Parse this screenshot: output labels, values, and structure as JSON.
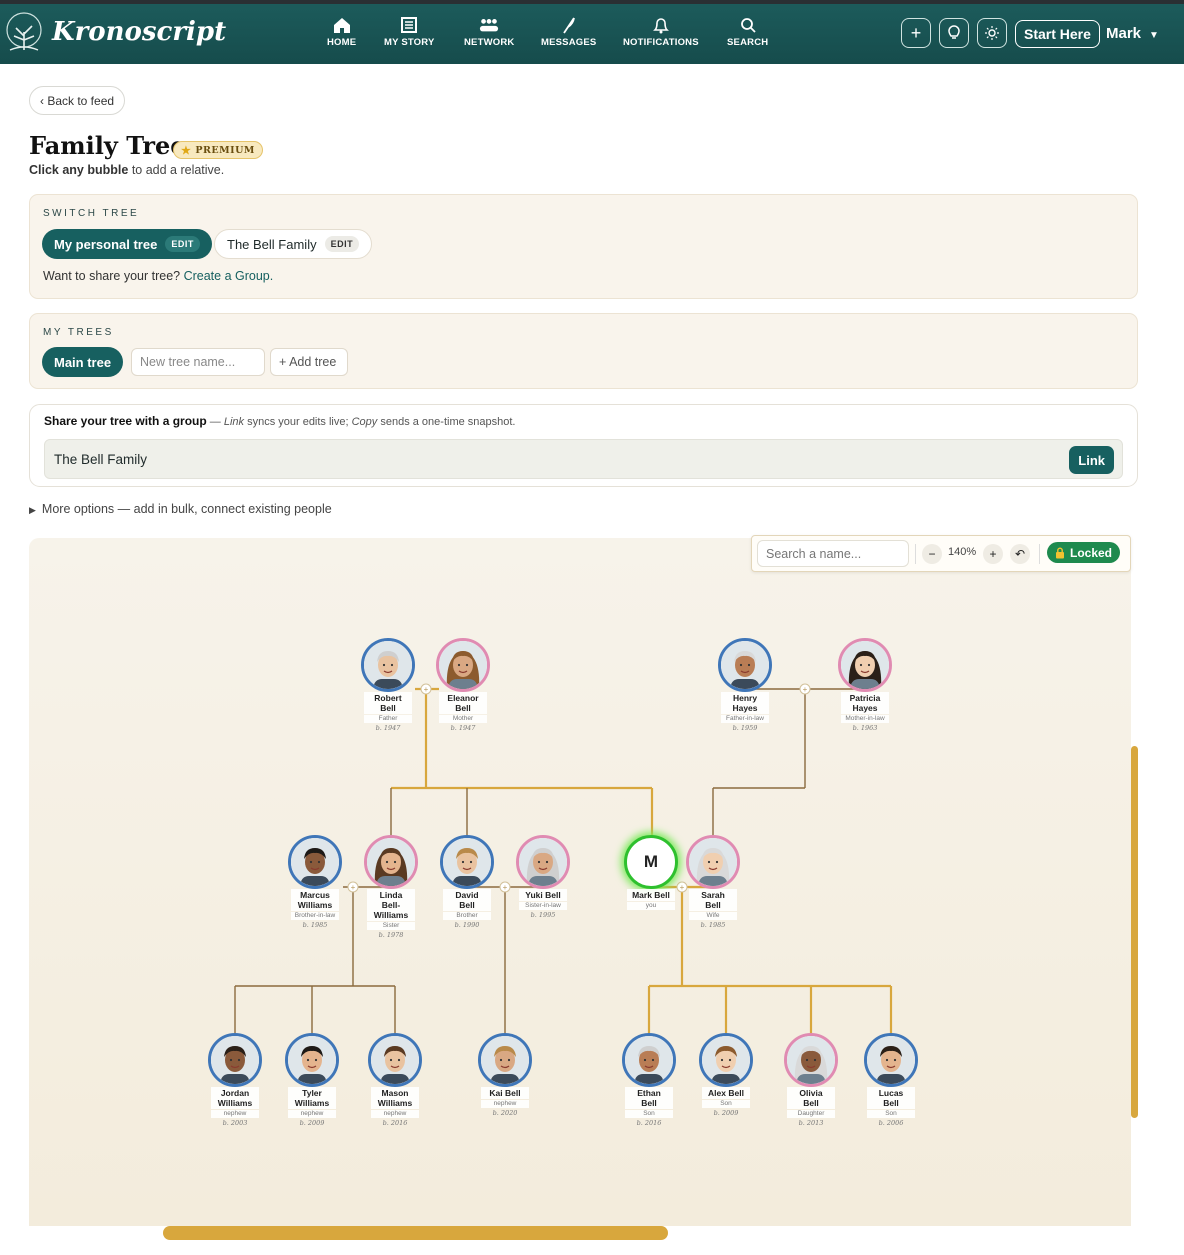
{
  "brand": {
    "name": "Kronoscript"
  },
  "nav": [
    {
      "label": "HOME",
      "icon": "home-icon"
    },
    {
      "label": "MY STORY",
      "icon": "book-icon"
    },
    {
      "label": "NETWORK",
      "icon": "people-icon"
    },
    {
      "label": "MESSAGES",
      "icon": "feather-icon"
    },
    {
      "label": "NOTIFICATIONS",
      "icon": "bell-icon"
    },
    {
      "label": "SEARCH",
      "icon": "search-icon"
    }
  ],
  "header": {
    "start_here": "Start Here",
    "user": "Mark"
  },
  "back": "‹ Back to feed",
  "page": {
    "title": "Family Tree",
    "premium": "PREMIUM",
    "subtitle_bold": "Click any bubble",
    "subtitle_rest": " to add a relative."
  },
  "switch_tree": {
    "label": "SWITCH TREE",
    "trees": [
      {
        "name": "My personal tree",
        "badge": "EDIT"
      },
      {
        "name": "The Bell Family",
        "badge": "EDIT"
      }
    ],
    "share_prompt": "Want to share your tree? ",
    "create_group": "Create a Group."
  },
  "my_trees": {
    "label": "MY TREES",
    "active": "Main tree",
    "new_placeholder": "New tree name...",
    "add": "+ Add tree"
  },
  "share_group": {
    "title": "Share your tree with a group",
    "dash": " — ",
    "link_word": "Link",
    "mid": " syncs your edits live; ",
    "copy_word": "Copy",
    "end": " sends a one-time snapshot.",
    "selected_group": "The Bell Family",
    "link_button": "Link"
  },
  "more_options": "More options — add in bulk, connect existing people",
  "canvas_toolbar": {
    "search_placeholder": "Search a name...",
    "zoom_out": "−",
    "zoom": "140%",
    "zoom_in": "+",
    "reset": "↶",
    "locked": "Locked"
  },
  "people": [
    {
      "first": "Robert",
      "last": "Bell",
      "role": "Father",
      "year": "b. 1947",
      "sex": "m"
    },
    {
      "first": "Eleanor",
      "last": "Bell",
      "role": "Mother",
      "year": "b. 1947",
      "sex": "f"
    },
    {
      "first": "Henry",
      "last": "Hayes",
      "role": "Father-in-law",
      "year": "b. 1959",
      "sex": "m"
    },
    {
      "first": "Patricia",
      "last": "Hayes",
      "role": "Mother-in-law",
      "year": "b. 1963",
      "sex": "f"
    },
    {
      "first": "Marcus",
      "last": "Williams",
      "role": "Brother-in-law",
      "year": "b. 1985",
      "sex": "m"
    },
    {
      "first": "Linda",
      "last": "Bell-Williams",
      "role": "Sister",
      "year": "b. 1978",
      "sex": "f"
    },
    {
      "first": "David",
      "last": "Bell",
      "role": "Brother",
      "year": "b. 1990",
      "sex": "m"
    },
    {
      "first": "Yuki",
      "last": "Bell",
      "role": "Sister-in-law",
      "year": "b. 1995",
      "sex": "f"
    },
    {
      "first": "Mark",
      "last": "Bell",
      "role": "you",
      "year": "",
      "sex": "me",
      "initial": "M"
    },
    {
      "first": "Sarah",
      "last": "Bell",
      "role": "Wife",
      "year": "b. 1985",
      "sex": "f"
    },
    {
      "first": "Jordan",
      "last": "Williams",
      "role": "nephew",
      "year": "b. 2003",
      "sex": "m"
    },
    {
      "first": "Tyler",
      "last": "Williams",
      "role": "nephew",
      "year": "b. 2009",
      "sex": "m"
    },
    {
      "first": "Mason",
      "last": "Williams",
      "role": "nephew",
      "year": "b. 2016",
      "sex": "m"
    },
    {
      "first": "Kai",
      "last": "Bell",
      "role": "nephew",
      "year": "b. 2020",
      "sex": "m"
    },
    {
      "first": "Ethan",
      "last": "Bell",
      "role": "Son",
      "year": "b. 2016",
      "sex": "m"
    },
    {
      "first": "Alex",
      "last": "Bell",
      "role": "Son",
      "year": "b. 2009",
      "sex": "m"
    },
    {
      "first": "Olivia",
      "last": "Bell",
      "role": "Daughter",
      "year": "b. 2013",
      "sex": "f"
    },
    {
      "first": "Lucas",
      "last": "Bell",
      "role": "Son",
      "year": "b. 2006",
      "sex": "m"
    }
  ],
  "colors": {
    "primary": "#176060",
    "gold_line": "#d8a73d",
    "brown_line": "#8b6a3e",
    "male_ring": "#3f76b8",
    "female_ring": "#e08bb2",
    "me_ring": "#2ec02e",
    "locked": "#1e8a4e"
  }
}
